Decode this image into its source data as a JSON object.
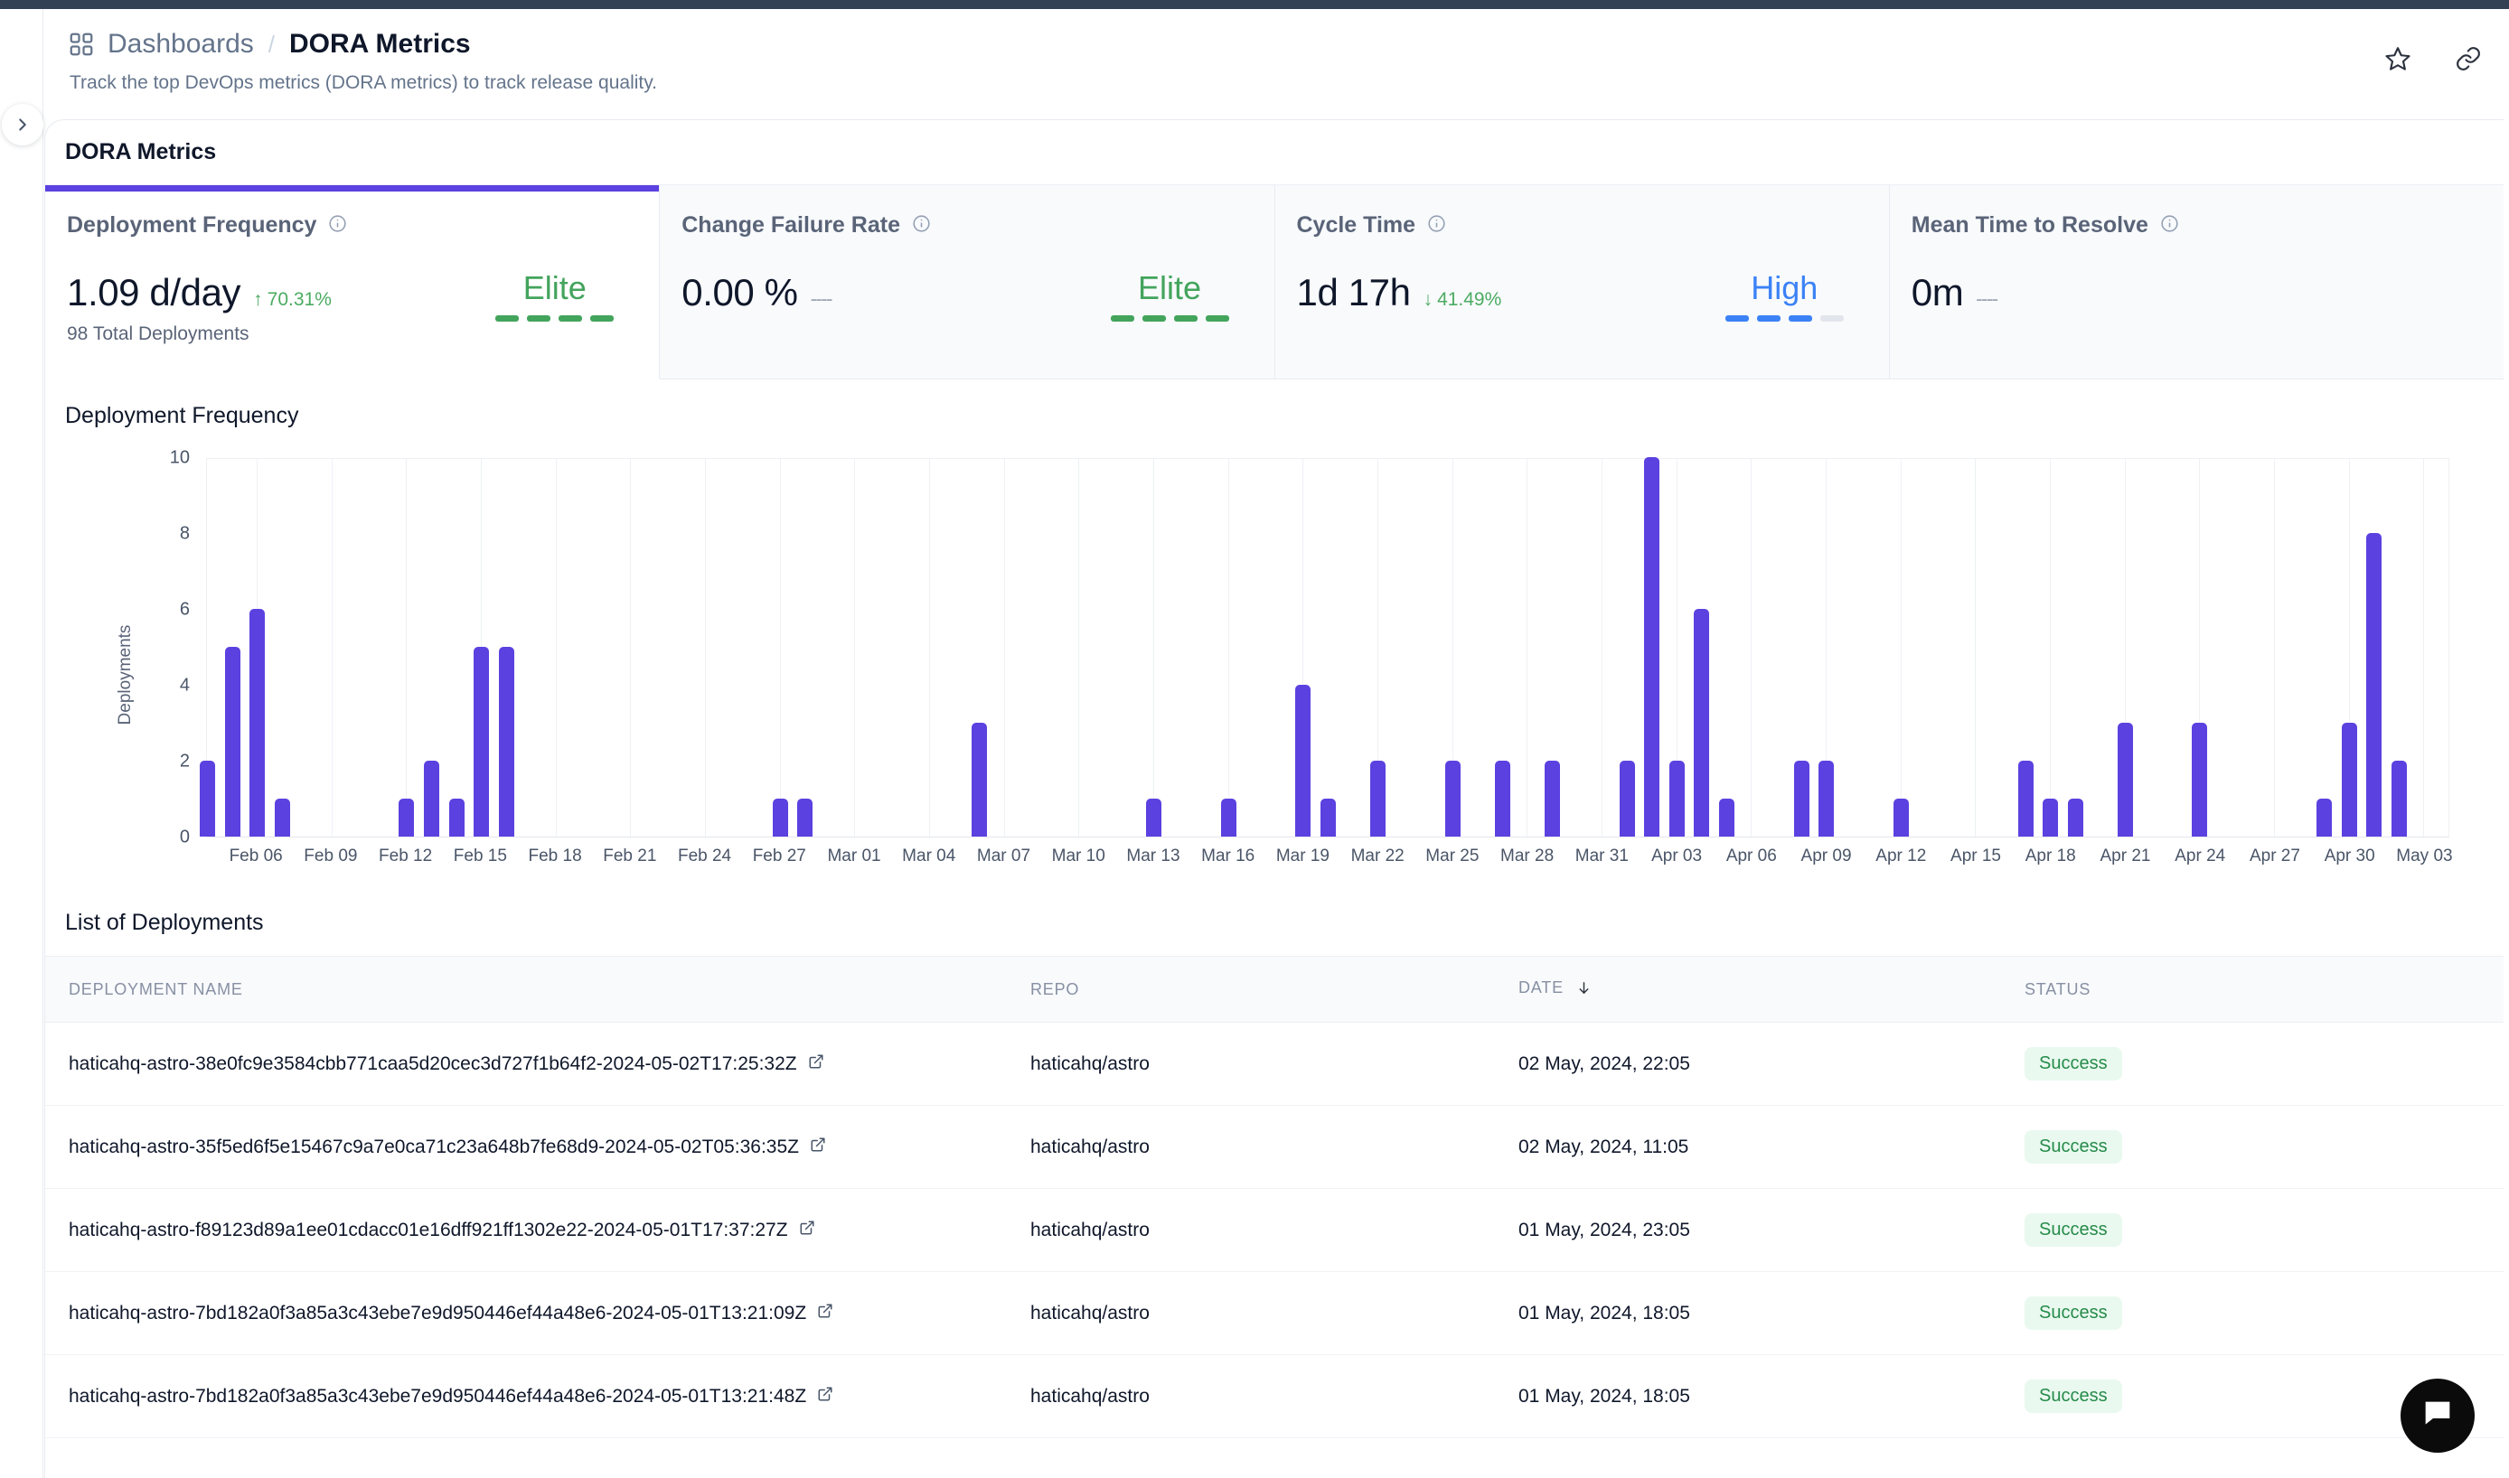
{
  "breadcrumb": {
    "grid_icon": "grid-icon",
    "root": "Dashboards",
    "separator": "/",
    "current": "DORA Metrics"
  },
  "subtitle": "Track the top DevOps metrics (DORA metrics) to track release quality.",
  "header_actions": [
    {
      "icon": "star-icon",
      "name": "favorite-button"
    },
    {
      "icon": "link-icon",
      "name": "copy-link-button"
    }
  ],
  "sidebar_toggle_icon": "chevron-right-icon",
  "card": {
    "title": "DORA Metrics"
  },
  "metrics": [
    {
      "title": "Deployment Frequency",
      "info_icon": "info-icon",
      "value": "1.09 d/day",
      "delta": "70.31%",
      "delta_direction": "up",
      "delta_arrow": "↑",
      "sub": "98 Total Deployments",
      "rating": "Elite",
      "rating_class": "elite",
      "dashes_filled": 4,
      "active": true
    },
    {
      "title": "Change Failure Rate",
      "info_icon": "info-icon",
      "value": "0.00 %",
      "delta": "----",
      "delta_direction": "none",
      "delta_arrow": "",
      "sub": "",
      "rating": "Elite",
      "rating_class": "elite",
      "dashes_filled": 4,
      "active": false
    },
    {
      "title": "Cycle Time",
      "info_icon": "info-icon",
      "value": "1d 17h",
      "delta": "41.49%",
      "delta_direction": "down",
      "delta_arrow": "↓",
      "sub": "",
      "rating": "High",
      "rating_class": "high",
      "dashes_filled": 3,
      "active": false
    },
    {
      "title": "Mean Time to Resolve",
      "info_icon": "info-icon",
      "value": "0m",
      "delta": "----",
      "delta_direction": "none",
      "delta_arrow": "",
      "sub": "",
      "rating": "",
      "rating_class": "",
      "dashes_filled": 0,
      "active": false
    }
  ],
  "chart_section_title": "Deployment Frequency",
  "chart_data": {
    "type": "bar",
    "title": "Deployment Frequency",
    "xlabel": "",
    "ylabel": "Deployments",
    "ylim": [
      0,
      10
    ],
    "yticks": [
      0,
      2,
      4,
      6,
      8,
      10
    ],
    "grid": true,
    "legend": null,
    "xticks": [
      "Feb 06",
      "Feb 09",
      "Feb 12",
      "Feb 15",
      "Feb 18",
      "Feb 21",
      "Feb 24",
      "Feb 27",
      "Mar 01",
      "Mar 04",
      "Mar 07",
      "Mar 10",
      "Mar 13",
      "Mar 16",
      "Mar 19",
      "Mar 22",
      "Mar 25",
      "Mar 28",
      "Mar 31",
      "Apr 03",
      "Apr 06",
      "Apr 09",
      "Apr 12",
      "Apr 15",
      "Apr 18",
      "Apr 21",
      "Apr 24",
      "Apr 27",
      "Apr 30",
      "May 03"
    ],
    "x_start": "Feb 04",
    "x_end": "May 04",
    "bars": [
      {
        "date": "Feb 04",
        "value": 2
      },
      {
        "date": "Feb 05",
        "value": 5
      },
      {
        "date": "Feb 06",
        "value": 6
      },
      {
        "date": "Feb 07",
        "value": 1
      },
      {
        "date": "Feb 12",
        "value": 1
      },
      {
        "date": "Feb 13",
        "value": 2
      },
      {
        "date": "Feb 14",
        "value": 1
      },
      {
        "date": "Feb 15",
        "value": 5
      },
      {
        "date": "Feb 16",
        "value": 5
      },
      {
        "date": "Feb 27",
        "value": 1
      },
      {
        "date": "Feb 28",
        "value": 1
      },
      {
        "date": "Mar 06",
        "value": 3
      },
      {
        "date": "Mar 13",
        "value": 1
      },
      {
        "date": "Mar 16",
        "value": 1
      },
      {
        "date": "Mar 19",
        "value": 4
      },
      {
        "date": "Mar 20",
        "value": 1
      },
      {
        "date": "Mar 22",
        "value": 2
      },
      {
        "date": "Mar 25",
        "value": 2
      },
      {
        "date": "Mar 27",
        "value": 2
      },
      {
        "date": "Mar 29",
        "value": 2
      },
      {
        "date": "Apr 01",
        "value": 2
      },
      {
        "date": "Apr 02",
        "value": 10
      },
      {
        "date": "Apr 03",
        "value": 2
      },
      {
        "date": "Apr 04",
        "value": 6
      },
      {
        "date": "Apr 05",
        "value": 1
      },
      {
        "date": "Apr 08",
        "value": 2
      },
      {
        "date": "Apr 09",
        "value": 2
      },
      {
        "date": "Apr 12",
        "value": 1
      },
      {
        "date": "Apr 17",
        "value": 2
      },
      {
        "date": "Apr 18",
        "value": 1
      },
      {
        "date": "Apr 19",
        "value": 1
      },
      {
        "date": "Apr 21",
        "value": 3
      },
      {
        "date": "Apr 24",
        "value": 3
      },
      {
        "date": "Apr 29",
        "value": 1
      },
      {
        "date": "Apr 30",
        "value": 3
      },
      {
        "date": "May 01",
        "value": 8
      },
      {
        "date": "May 02",
        "value": 2
      }
    ],
    "color": "#5b41e0"
  },
  "table": {
    "title": "List of Deployments",
    "columns": [
      {
        "label": "DEPLOYMENT NAME",
        "sorted": false
      },
      {
        "label": "REPO",
        "sorted": false
      },
      {
        "label": "DATE",
        "sorted": true,
        "sort_icon": "arrow-down-icon"
      },
      {
        "label": "STATUS",
        "sorted": false
      }
    ],
    "rows": [
      {
        "name": "haticahq-astro-38e0fc9e3584cbb771caa5d20cec3d727f1b64f2-2024-05-02T17:25:32Z",
        "repo": "haticahq/astro",
        "date": "02 May, 2024, 22:05",
        "status": "Success"
      },
      {
        "name": "haticahq-astro-35f5ed6f5e15467c9a7e0ca71c23a648b7fe68d9-2024-05-02T05:36:35Z",
        "repo": "haticahq/astro",
        "date": "02 May, 2024, 11:05",
        "status": "Success"
      },
      {
        "name": "haticahq-astro-f89123d89a1ee01cdacc01e16dff921ff1302e22-2024-05-01T17:37:27Z",
        "repo": "haticahq/astro",
        "date": "01 May, 2024, 23:05",
        "status": "Success"
      },
      {
        "name": "haticahq-astro-7bd182a0f3a85a3c43ebe7e9d950446ef44a48e6-2024-05-01T13:21:09Z",
        "repo": "haticahq/astro",
        "date": "01 May, 2024, 18:05",
        "status": "Success"
      },
      {
        "name": "haticahq-astro-7bd182a0f3a85a3c43ebe7e9d950446ef44a48e6-2024-05-01T13:21:48Z",
        "repo": "haticahq/astro",
        "date": "01 May, 2024, 18:05",
        "status": "Success"
      }
    ],
    "external_link_icon": "external-link-icon"
  },
  "chat_widget": {
    "icon": "chat-bubble-icon"
  },
  "colors": {
    "accent": "#5b41e0",
    "elite": "#43a45c",
    "high": "#3b82f6",
    "success_text": "#268b4a",
    "success_bg": "#e9f9ef"
  }
}
